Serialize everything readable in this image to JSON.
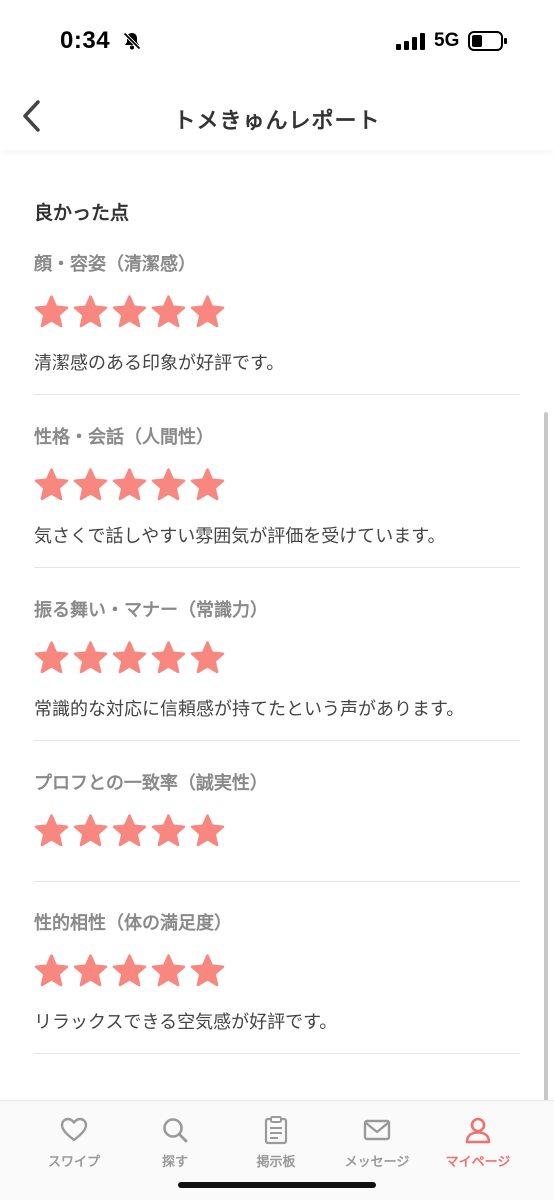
{
  "status_bar": {
    "time": "0:34",
    "network": "5G"
  },
  "header": {
    "title": "トメきゅんレポート"
  },
  "report": {
    "section_title": "良かった点",
    "criteria": [
      {
        "label": "顔・容姿（清潔感）",
        "rating": 5,
        "max_rating": 5,
        "comment": "清潔感のある印象が好評です。"
      },
      {
        "label": "性格・会話（人間性）",
        "rating": 5,
        "max_rating": 5,
        "comment": "気さくで話しやすい雰囲気が評価を受けています。"
      },
      {
        "label": "振る舞い・マナー（常識力）",
        "rating": 5,
        "max_rating": 5,
        "comment": "常識的な対応に信頼感が持てたという声があります。"
      },
      {
        "label": "プロフとの一致率（誠実性）",
        "rating": 5,
        "max_rating": 5,
        "comment": ""
      },
      {
        "label": "性的相性（体の満足度）",
        "rating": 5,
        "max_rating": 5,
        "comment": "リラックスできる空気感が好評です。"
      }
    ]
  },
  "tabbar": {
    "items": [
      {
        "label": "スワイプ",
        "icon": "heart-icon",
        "active": false
      },
      {
        "label": "探す",
        "icon": "search-icon",
        "active": false
      },
      {
        "label": "掲示板",
        "icon": "clipboard-icon",
        "active": false
      },
      {
        "label": "メッセージ",
        "icon": "mail-icon",
        "active": false
      },
      {
        "label": "マイページ",
        "icon": "person-icon",
        "active": true
      }
    ]
  },
  "colors": {
    "star": "#f8877f",
    "active_tab": "#f0716b",
    "inactive_tab": "#9a9a9a",
    "label": "#8a8a8a"
  }
}
